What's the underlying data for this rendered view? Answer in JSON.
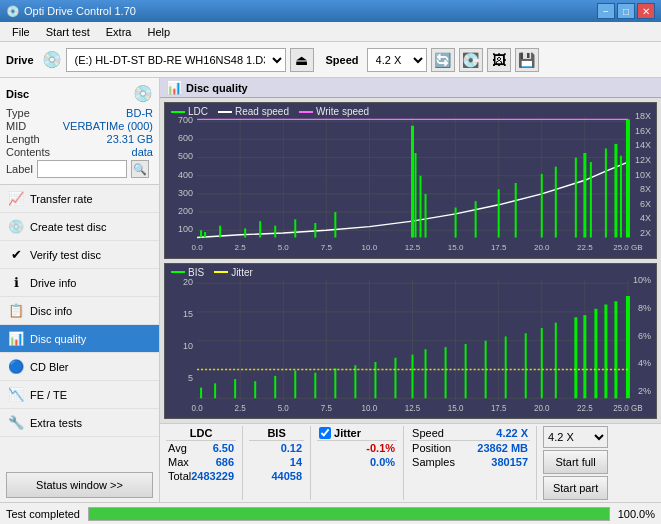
{
  "window": {
    "title": "Opti Drive Control 1.70",
    "minimize": "−",
    "maximize": "□",
    "close": "✕"
  },
  "menu": {
    "items": [
      "File",
      "Start test",
      "Extra",
      "Help"
    ]
  },
  "toolbar": {
    "drive_label": "Drive",
    "drive_value": "(E:)  HL-DT-ST BD-RE  WH16NS48 1.D3",
    "speed_label": "Speed",
    "speed_value": "4.2 X"
  },
  "disc_panel": {
    "title": "Disc",
    "type_label": "Type",
    "type_value": "BD-R",
    "mid_label": "MID",
    "mid_value": "VERBATIMe (000)",
    "length_label": "Length",
    "length_value": "23.31 GB",
    "contents_label": "Contents",
    "contents_value": "data",
    "label_label": "Label",
    "label_value": ""
  },
  "sidebar_nav": {
    "items": [
      {
        "id": "transfer-rate",
        "label": "Transfer rate",
        "icon": "📈"
      },
      {
        "id": "create-test-disc",
        "label": "Create test disc",
        "icon": "💿"
      },
      {
        "id": "verify-test-disc",
        "label": "Verify test disc",
        "icon": "✔"
      },
      {
        "id": "drive-info",
        "label": "Drive info",
        "icon": "ℹ"
      },
      {
        "id": "disc-info",
        "label": "Disc info",
        "icon": "📋"
      },
      {
        "id": "disc-quality",
        "label": "Disc quality",
        "icon": "📊",
        "active": true
      },
      {
        "id": "cd-bler",
        "label": "CD Bler",
        "icon": "🔵"
      },
      {
        "id": "fe-te",
        "label": "FE / TE",
        "icon": "📉"
      },
      {
        "id": "extra-tests",
        "label": "Extra tests",
        "icon": "🔧"
      }
    ],
    "status_btn": "Status window >>"
  },
  "disc_quality_header": "Disc quality",
  "chart_top": {
    "title": "LDC",
    "legend": [
      {
        "label": "LDC",
        "color": "#00ff00"
      },
      {
        "label": "Read speed",
        "color": "#ffffff"
      },
      {
        "label": "Write speed",
        "color": "#ff66ff"
      }
    ],
    "y_axis_left": [
      "700",
      "600",
      "500",
      "400",
      "300",
      "200",
      "100"
    ],
    "y_axis_right": [
      "18X",
      "16X",
      "14X",
      "12X",
      "10X",
      "8X",
      "6X",
      "4X",
      "2X"
    ],
    "x_axis": [
      "0.0",
      "2.5",
      "5.0",
      "7.5",
      "10.0",
      "12.5",
      "15.0",
      "17.5",
      "20.0",
      "22.5",
      "25.0 GB"
    ]
  },
  "chart_bottom": {
    "title": "BIS",
    "legend": [
      {
        "label": "BIS",
        "color": "#00ff00"
      },
      {
        "label": "Jitter",
        "color": "#ffff00"
      }
    ],
    "y_axis_left": [
      "20",
      "15",
      "10",
      "5"
    ],
    "y_axis_right": [
      "10%",
      "8%",
      "6%",
      "4%",
      "2%"
    ],
    "x_axis": [
      "0.0",
      "2.5",
      "5.0",
      "7.5",
      "10.0",
      "12.5",
      "15.0",
      "17.5",
      "20.0",
      "22.5",
      "25.0 GB"
    ]
  },
  "stats": {
    "ldc_header": "LDC",
    "bis_header": "BIS",
    "jitter_header": "Jitter",
    "avg_label": "Avg",
    "max_label": "Max",
    "total_label": "Total",
    "ldc_avg": "6.50",
    "ldc_max": "686",
    "ldc_total": "2483229",
    "bis_avg": "0.12",
    "bis_max": "14",
    "bis_total": "44058",
    "jitter_avg": "-0.1%",
    "jitter_max": "0.0%",
    "speed_label": "Speed",
    "speed_value": "4.22 X",
    "speed_select": "4.2 X",
    "position_label": "Position",
    "position_value": "23862 MB",
    "samples_label": "Samples",
    "samples_value": "380157",
    "start_full": "Start full",
    "start_part": "Start part",
    "jitter_checkbox": true
  },
  "status_bar": {
    "text": "Test completed",
    "progress": 100
  }
}
